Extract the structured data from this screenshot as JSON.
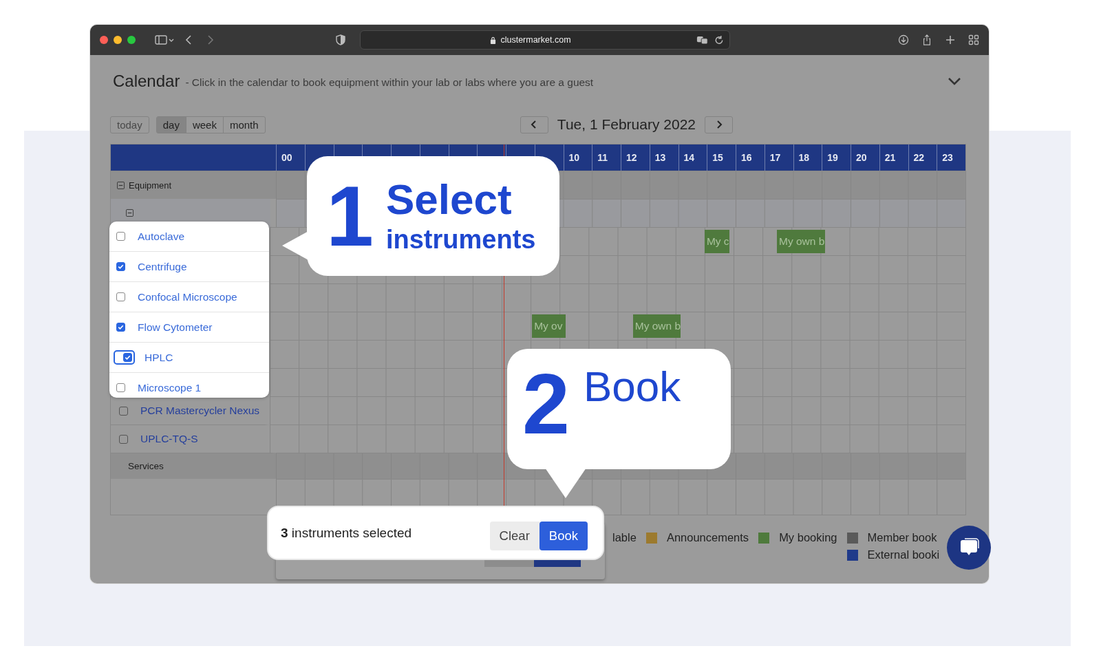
{
  "browser": {
    "url": "clustermarket.com"
  },
  "header": {
    "title": "Calendar",
    "subtitle": "- Click in the calendar to book equipment within your lab or labs where you are a guest",
    "expanded": true
  },
  "today": "today",
  "views": [
    {
      "label": "day",
      "selected": true
    },
    {
      "label": "week",
      "selected": false
    },
    {
      "label": "month",
      "selected": false
    }
  ],
  "date": "Tue, 1 February 2022",
  "hours": [
    "00",
    "10",
    "11",
    "12",
    "13",
    "14",
    "15",
    "16",
    "17",
    "18",
    "19",
    "20",
    "21",
    "22",
    "23"
  ],
  "equipment": {
    "label": "Equipment",
    "expanded": true,
    "subgroup_expanded": true,
    "items": [
      {
        "name": "Autoclave",
        "checked": false,
        "highlighted": true,
        "focused": false,
        "bookings": [
          {
            "label": "My c"
          },
          {
            "label": "My own b"
          }
        ]
      },
      {
        "name": "Centrifuge",
        "checked": true,
        "highlighted": true,
        "focused": false
      },
      {
        "name": "Confocal Microscope",
        "checked": false,
        "highlighted": true,
        "focused": false
      },
      {
        "name": "Flow Cytometer",
        "checked": true,
        "highlighted": true,
        "focused": false,
        "bookings": [
          {
            "label": "My ov"
          },
          {
            "label": "My own b"
          }
        ]
      },
      {
        "name": "HPLC",
        "checked": true,
        "highlighted": true,
        "focused": true
      },
      {
        "name": "Microscope 1",
        "checked": false,
        "highlighted": true,
        "focused": false
      },
      {
        "name": "PCR Mastercycler Nexus",
        "checked": false,
        "highlighted": false,
        "focused": false
      },
      {
        "name": "UPLC-TQ-S",
        "checked": false,
        "highlighted": false,
        "focused": false
      }
    ]
  },
  "services": {
    "label": "Services"
  },
  "legend": [
    {
      "label": "lable"
    },
    {
      "label": "Announcements",
      "color": "#9c7a2e"
    },
    {
      "label": "My booking",
      "color": "#4e7a3c"
    },
    {
      "label": "Member book",
      "color": "#5a5a5a"
    },
    {
      "label": "External booki",
      "color": "#1f3a8a"
    }
  ],
  "callouts": [
    {
      "number": "1",
      "title": "Select",
      "subtitle": "instruments"
    },
    {
      "number": "2",
      "title": "Book"
    }
  ],
  "selection_bar": {
    "text": "**3** instruments selected",
    "buttons": [
      {
        "label": "Clear",
        "kind": "secondary"
      },
      {
        "label": "Book",
        "kind": "primary"
      }
    ]
  }
}
